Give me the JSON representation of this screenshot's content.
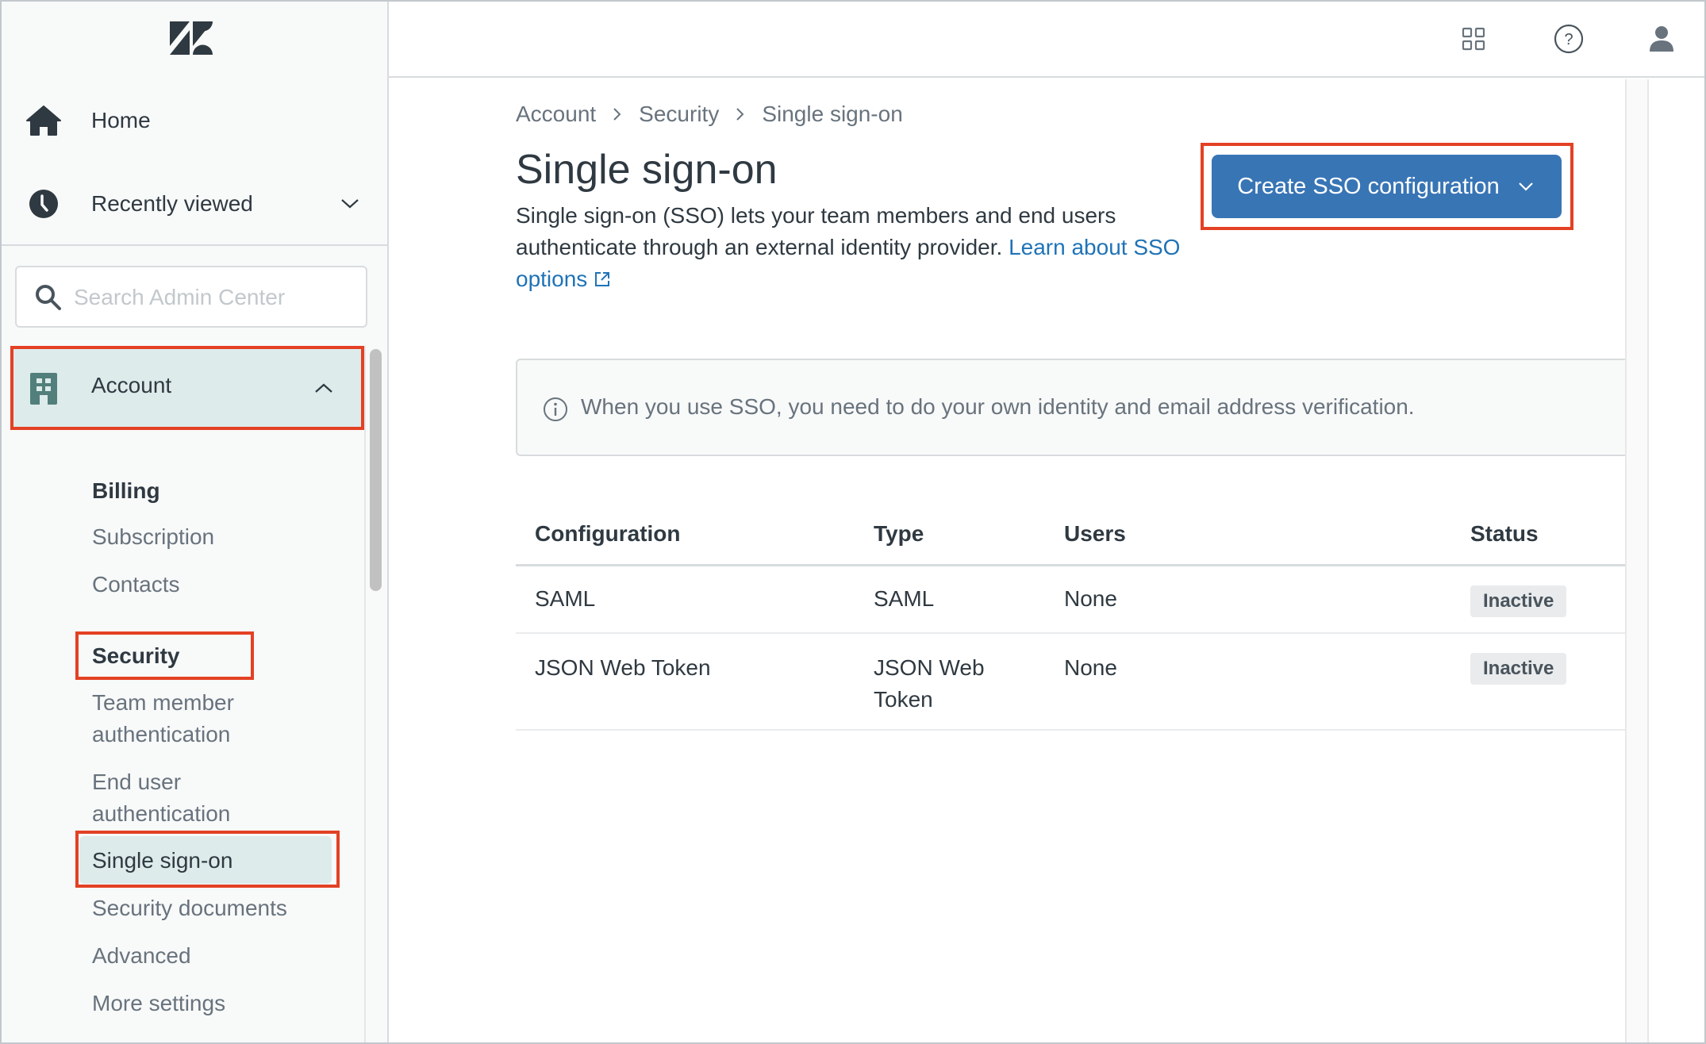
{
  "sidebar": {
    "logo": "zendesk-logo",
    "home_label": "Home",
    "recently_viewed_label": "Recently viewed",
    "search_placeholder": "Search Admin Center",
    "search_value": "",
    "account_label": "Account",
    "items": [
      {
        "label": "Billing",
        "type": "heading"
      },
      {
        "label": "Subscription",
        "type": "link"
      },
      {
        "label": "Contacts",
        "type": "link"
      },
      {
        "label": "Security",
        "type": "heading"
      },
      {
        "label": "Team member authentication",
        "type": "link"
      },
      {
        "label": "End user authentication",
        "type": "link"
      },
      {
        "label": "Single sign-on",
        "type": "link",
        "active": true
      },
      {
        "label": "Security documents",
        "type": "link"
      },
      {
        "label": "Advanced",
        "type": "link"
      },
      {
        "label": "More settings",
        "type": "link"
      }
    ]
  },
  "header": {
    "icons": [
      "products-grid-icon",
      "help-icon",
      "user-profile-icon"
    ]
  },
  "breadcrumb": [
    "Account",
    "Security",
    "Single sign-on"
  ],
  "page": {
    "title": "Single sign-on",
    "description": "Single sign-on (SSO) lets your team members and end users authenticate through an external identity provider.",
    "learn_link": "Learn about SSO options",
    "create_button": "Create SSO configuration",
    "info_text": "When you use SSO, you need to do your own identity and email address verification."
  },
  "table": {
    "columns": [
      "Configuration",
      "Type",
      "Users",
      "Status"
    ],
    "rows": [
      {
        "configuration": "SAML",
        "type": "SAML",
        "users": "None",
        "status": "Inactive"
      },
      {
        "configuration": "JSON Web Token",
        "type": "JSON Web Token",
        "users": "None",
        "status": "Inactive"
      }
    ]
  },
  "colors": {
    "accent": "#3875b5",
    "link": "#1f73b7",
    "highlight": "#ddebeb",
    "annotation_red": "#e34124",
    "badge_bg": "#e9ebed"
  }
}
